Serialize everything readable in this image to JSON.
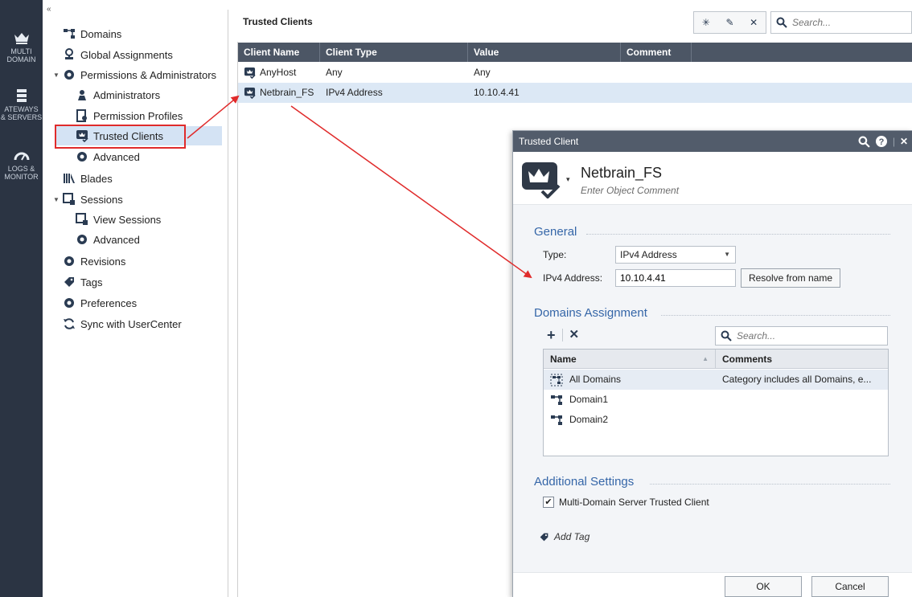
{
  "rail": {
    "items": [
      {
        "label": "MULTI\nDOMAIN",
        "icon": "crown-icon"
      },
      {
        "label": "ATEWAYS\n& SERVERS",
        "icon": "servers-icon"
      },
      {
        "label": "LOGS &\nMONITOR",
        "icon": "gauge-icon"
      }
    ]
  },
  "nav": {
    "collapse": "«",
    "items": [
      {
        "label": "Domains"
      },
      {
        "label": "Global Assignments"
      },
      {
        "label": "Permissions & Administrators"
      },
      {
        "label": "Administrators"
      },
      {
        "label": "Permission Profiles"
      },
      {
        "label": "Trusted Clients"
      },
      {
        "label": "Advanced"
      },
      {
        "label": "Blades"
      },
      {
        "label": "Sessions"
      },
      {
        "label": "View Sessions"
      },
      {
        "label": "Advanced"
      },
      {
        "label": "Revisions"
      },
      {
        "label": "Tags"
      },
      {
        "label": "Preferences"
      },
      {
        "label": "Sync with UserCenter"
      }
    ]
  },
  "main": {
    "title": "Trusted Clients",
    "search_placeholder": "Search...",
    "columns": [
      "Client Name",
      "Client Type",
      "Value",
      "Comment"
    ],
    "rows": [
      {
        "name": "AnyHost",
        "type": "Any",
        "value": "Any",
        "comment": ""
      },
      {
        "name": "Netbrain_FS",
        "type": "IPv4 Address",
        "value": "10.10.4.41",
        "comment": ""
      }
    ]
  },
  "dialog": {
    "title": "Trusted Client",
    "object_name": "Netbrain_FS",
    "object_comment": "Enter Object Comment",
    "general": {
      "title": "General",
      "type_label": "Type:",
      "type_value": "IPv4 Address",
      "ipv4_label": "IPv4 Address:",
      "ipv4_value": "10.10.4.41",
      "resolve_label": "Resolve from name"
    },
    "domains": {
      "title": "Domains Assignment",
      "search_placeholder": "Search...",
      "columns": [
        "Name",
        "Comments"
      ],
      "rows": [
        {
          "name": "All Domains",
          "comment": "Category includes all Domains, e..."
        },
        {
          "name": "Domain1",
          "comment": ""
        },
        {
          "name": "Domain2",
          "comment": ""
        }
      ]
    },
    "additional": {
      "title": "Additional Settings",
      "mds_label": "Multi-Domain Server Trusted Client",
      "mds_checked": true,
      "add_tag": "Add Tag"
    },
    "ok_label": "OK",
    "cancel_label": "Cancel"
  },
  "colors": {
    "rail": "#2b3443",
    "table_header": "#4c5665",
    "dialog_title": "#525c6b",
    "section_title": "#3566a8",
    "annotation": "#e02b2b"
  }
}
